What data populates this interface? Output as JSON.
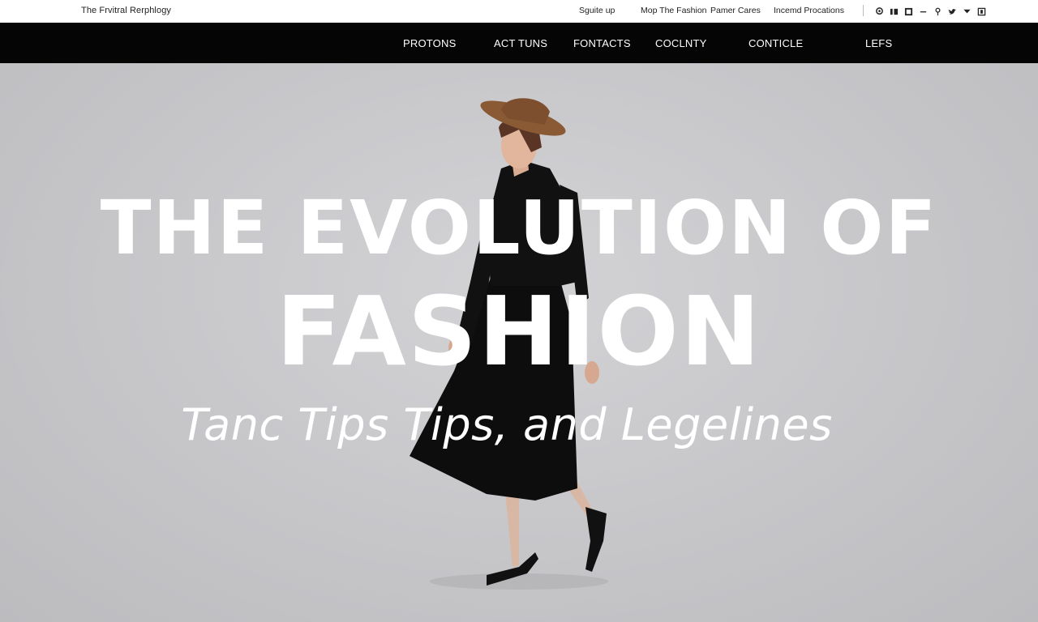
{
  "brand": "The Frvitral Rerphlogy",
  "utility_links": [
    "Sguite up",
    "Mop The Fashion",
    "Pamer Cares",
    "Incemd Procations"
  ],
  "social_icons": [
    "location-icon",
    "instagram-icon",
    "pinterest-icon",
    "dash-icon",
    "pin-icon",
    "twitter-icon",
    "twitter-bird-icon",
    "square-icon"
  ],
  "nav": [
    "PROTONS",
    "ACT TUNS",
    "FONTACTS",
    "COCLNTY",
    "CONTICLE",
    "LEFS"
  ],
  "hero": {
    "title_line1": "THE EVOLUTION OF",
    "title_line2": "FASHION",
    "subtitle": "Tanc Tips Tips, and Legelines"
  },
  "colors": {
    "nav_background": "#050505",
    "hero_background": "#c8c8cb",
    "hero_text": "#ffffff",
    "hat": "#8a5a35"
  }
}
